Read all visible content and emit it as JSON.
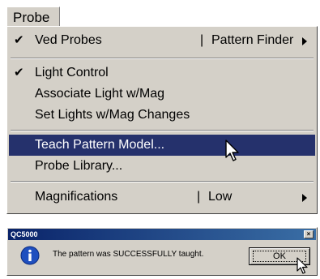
{
  "menubar": {
    "probe_label": "Probe"
  },
  "menu": {
    "items": [
      {
        "label": "Ved Probes",
        "checked": "✔",
        "sub_label": "Pattern Finder",
        "has_submenu": true
      },
      {
        "label": "Light Control",
        "checked": "✔"
      },
      {
        "label": "Associate Light w/Mag"
      },
      {
        "label": "Set Lights w/Mag Changes"
      },
      {
        "label": "Teach Pattern Model...",
        "highlighted": true
      },
      {
        "label": "Probe Library..."
      },
      {
        "label": "Magnifications",
        "sub_label": "Low",
        "has_submenu": true
      }
    ],
    "separator_char": "|"
  },
  "dialog": {
    "title": "QC5000",
    "close_label": "×",
    "message": "The pattern was SUCCESSFULLY taught.",
    "ok_label": "OK",
    "icon": "info-icon"
  },
  "colors": {
    "face": "#d4d0c8",
    "highlight": "#25316c",
    "titlebar_start": "#0a246a",
    "titlebar_end": "#3a6ea5"
  }
}
